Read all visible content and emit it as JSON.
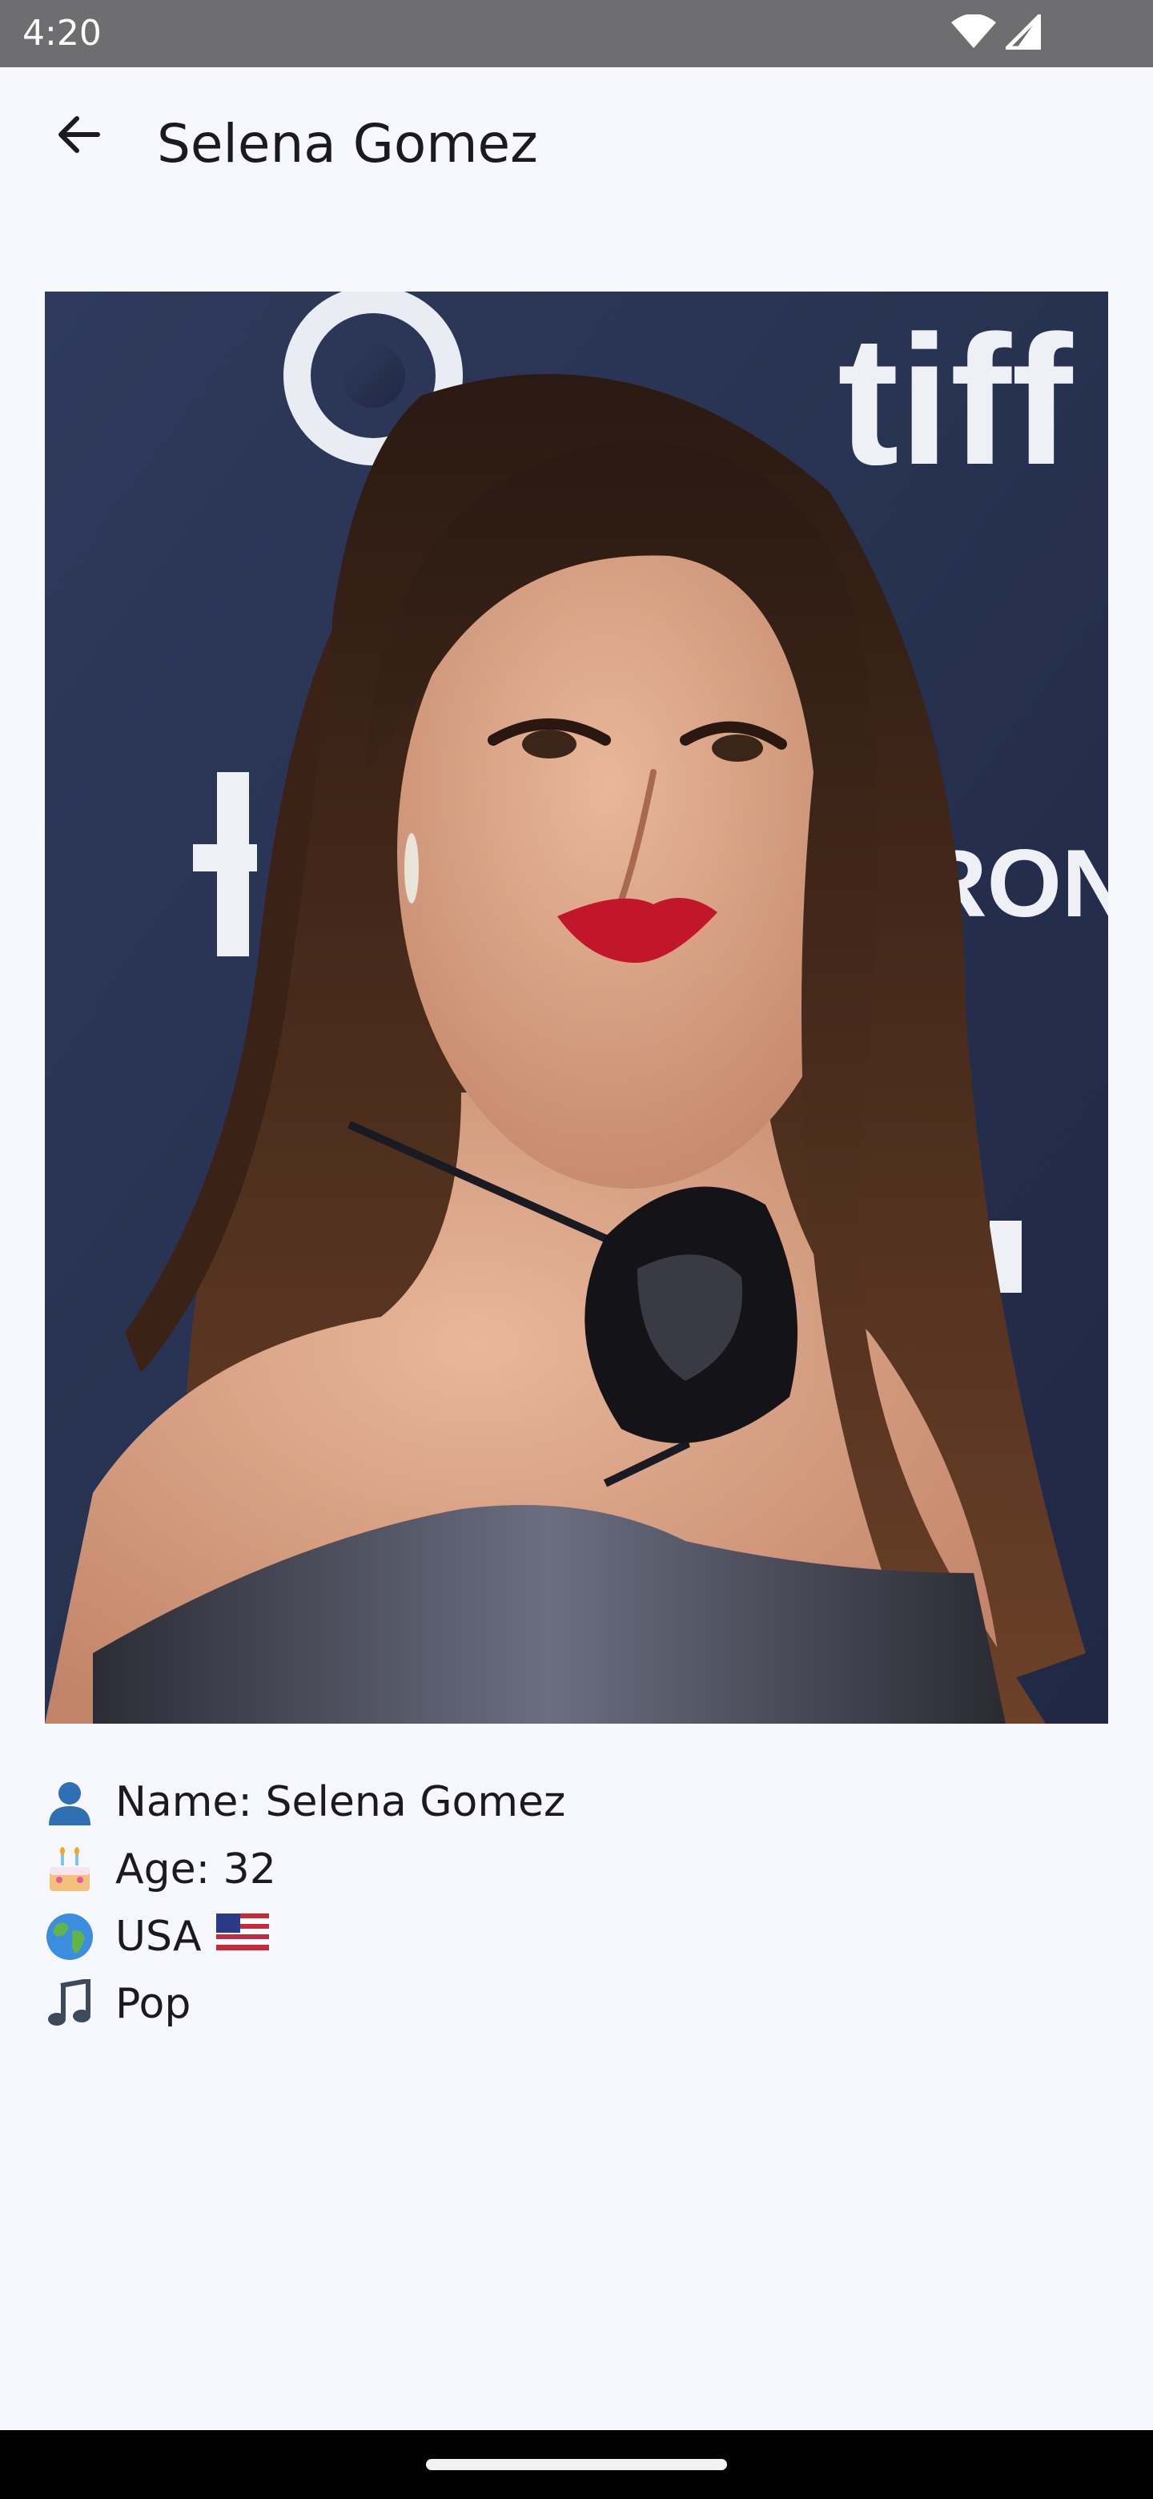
{
  "status_bar": {
    "time": "4:20",
    "icons": [
      "wifi-icon",
      "cellular-signal-icon"
    ]
  },
  "app_bar": {
    "back_icon": "arrow-back-icon",
    "title": "Selena Gomez"
  },
  "photo": {
    "backdrop_text_top": "tiff",
    "backdrop_text_side": "RONTO"
  },
  "info": {
    "name": {
      "icon": "person-icon",
      "text": "Name: Selena Gomez"
    },
    "age": {
      "icon": "birthday-cake-icon",
      "text": "Age: 32"
    },
    "country": {
      "icon": "globe-icon",
      "text": "USA",
      "flag": "us-flag-icon"
    },
    "genre": {
      "icon": "music-note-icon",
      "text": "Pop"
    }
  },
  "colors": {
    "background": "#f7f8fd",
    "status_bar": "#6e6e70",
    "text": "#1b1b1f",
    "nav_bar": "#000000"
  }
}
